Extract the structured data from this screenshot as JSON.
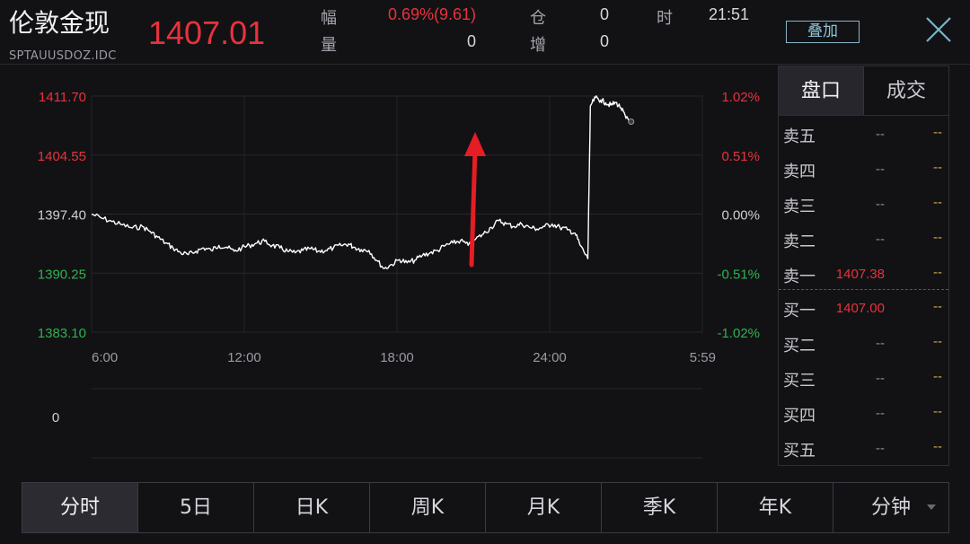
{
  "header": {
    "title": "伦敦金现",
    "code": "SPTAUUSDOZ.IDC",
    "price": "1407.01",
    "stats": {
      "change_label": "幅",
      "change_value": "0.69%(9.61)",
      "position_label": "仓",
      "position_value": "0",
      "time_label": "时",
      "time_value": "21:51",
      "volume_label": "量",
      "volume_value": "0",
      "increase_label": "增",
      "increase_value": "0"
    },
    "overlay_button": "叠加",
    "close_icon": "close-icon"
  },
  "chart_data": {
    "type": "line",
    "y_ticks": [
      "1411.70",
      "1404.55",
      "1397.40",
      "1390.25",
      "1383.10"
    ],
    "pct_ticks": [
      "1.02%",
      "0.51%",
      "0.00%",
      "-0.51%",
      "-1.02%"
    ],
    "x_ticks": [
      "6:00",
      "12:00",
      "18:00",
      "24:00",
      "5:59"
    ],
    "volume_label": "0",
    "ylim": [
      1383.1,
      1411.7
    ],
    "reference_price": 1397.4,
    "colors": {
      "up": "#e8323c",
      "down": "#2fb24f",
      "flat": "#cfcfd4",
      "line": "#ffffff",
      "arrow": "#e51d24"
    },
    "series": [
      {
        "values": [
          1397.4,
          1396.9,
          1396.5,
          1396.1,
          1395.7,
          1395.9,
          1395.3,
          1394.6,
          1393.9,
          1393.3,
          1392.7,
          1392.5,
          1392.9,
          1393.3,
          1393.0,
          1393.6,
          1393.4,
          1392.9,
          1393.3,
          1393.6,
          1393.9,
          1394.1,
          1393.6,
          1393.3,
          1392.9,
          1392.7,
          1393.0,
          1393.2,
          1392.9,
          1393.0,
          1393.3,
          1393.6,
          1393.8,
          1393.4,
          1393.1,
          1393.0,
          1391.8,
          1390.8,
          1391.3,
          1391.9,
          1391.5,
          1391.8,
          1392.4,
          1392.7,
          1393.0,
          1393.6,
          1393.9,
          1394.2,
          1393.6,
          1394.4,
          1395.0,
          1395.8,
          1396.6,
          1396.2,
          1395.9,
          1396.2,
          1395.8,
          1395.6,
          1395.9,
          1396.2,
          1395.8,
          1395.5,
          1395.1,
          1393.6,
          1392.0,
          1410.5,
          1411.5,
          1411.2,
          1410.9,
          1410.6,
          1410.9,
          1410.3,
          1409.0,
          1408.6
        ]
      }
    ],
    "x_start_hour": 6,
    "x_values_hours": [
      6.0,
      6.4,
      6.8,
      7.2,
      7.6,
      8.0,
      8.3,
      8.6,
      8.9,
      9.2,
      9.5,
      9.8,
      10.1,
      10.4,
      10.7,
      11.0,
      11.3,
      11.6,
      11.9,
      12.2,
      12.5,
      12.8,
      13.1,
      13.4,
      13.7,
      14.0,
      14.3,
      14.6,
      14.9,
      15.2,
      15.5,
      15.8,
      16.1,
      16.3,
      16.6,
      16.9,
      17.2,
      17.5,
      17.8,
      18.1,
      18.4,
      18.7,
      19.0,
      19.3,
      19.6,
      19.9,
      20.2,
      20.5,
      20.8,
      21.1,
      21.4,
      21.7,
      22.0,
      22.3,
      22.6,
      22.9,
      23.2,
      23.5,
      23.8,
      24.1,
      24.4,
      24.7,
      25.0,
      25.2,
      25.5,
      25.6,
      25.8,
      26.0,
      26.2,
      26.4,
      26.6,
      26.8,
      27.0,
      27.2
    ]
  },
  "orderbook": {
    "tabs": [
      "盘口",
      "成交"
    ],
    "asks": [
      {
        "label": "卖五",
        "price": "--",
        "vol": "--"
      },
      {
        "label": "卖四",
        "price": "--",
        "vol": "--"
      },
      {
        "label": "卖三",
        "price": "--",
        "vol": "--"
      },
      {
        "label": "卖二",
        "price": "--",
        "vol": "--"
      },
      {
        "label": "卖一",
        "price": "1407.38",
        "vol": "--"
      }
    ],
    "bids": [
      {
        "label": "买一",
        "price": "1407.00",
        "vol": "--"
      },
      {
        "label": "买二",
        "price": "--",
        "vol": "--"
      },
      {
        "label": "买三",
        "price": "--",
        "vol": "--"
      },
      {
        "label": "买四",
        "price": "--",
        "vol": "--"
      },
      {
        "label": "买五",
        "price": "--",
        "vol": "--"
      }
    ]
  },
  "period_tabs": [
    "分时",
    "5日",
    "日K",
    "周K",
    "月K",
    "季K",
    "年K",
    "分钟"
  ]
}
